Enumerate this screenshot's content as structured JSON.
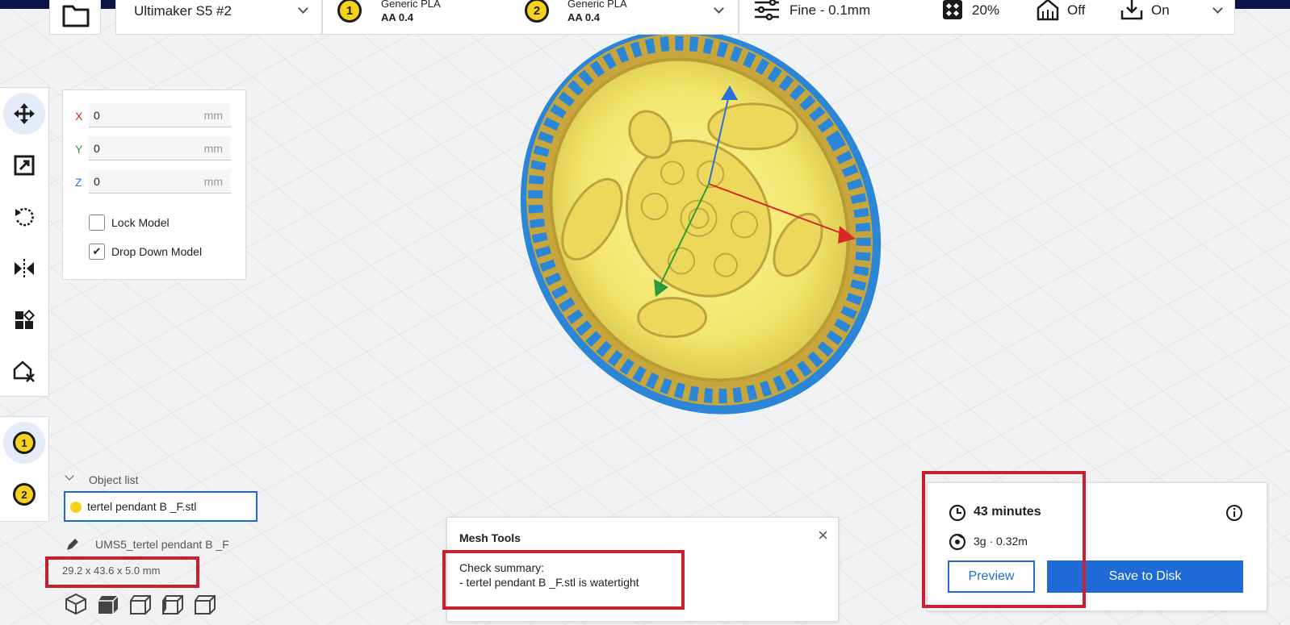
{
  "header": {
    "printer_name": "Ultimaker S5 #2",
    "extruder1": {
      "number": "1",
      "material": "Generic PLA",
      "nozzle": "AA 0.4"
    },
    "extruder2": {
      "number": "2",
      "material": "Generic PLA",
      "nozzle": "AA 0.4"
    },
    "profile": "Fine - 0.1mm",
    "infill": "20%",
    "support": "Off",
    "adhesion": "On"
  },
  "move_panel": {
    "x_label": "X",
    "x_value": "0",
    "y_label": "Y",
    "y_value": "0",
    "z_label": "Z",
    "z_value": "0",
    "unit": "mm",
    "lock_model": "Lock Model",
    "drop_down_model": "Drop Down Model",
    "drop_down_checkmark": "✔"
  },
  "extruder_select": {
    "e1": "1",
    "e2": "2"
  },
  "object_list": {
    "title": "Object list",
    "selected_item": "tertel pendant B _F.stl",
    "job_name": "UMS5_tertel pendant B _F",
    "dimensions": "29.2 x 43.6 x 5.0 mm"
  },
  "mesh_tools": {
    "title": "Mesh Tools",
    "summary_heading": "Check summary:",
    "summary_line": "- tertel pendant B _F.stl is watertight",
    "close": "×"
  },
  "print_info": {
    "time": "43 minutes",
    "material_usage": "3g · 0.32m",
    "preview_label": "Preview",
    "save_label": "Save to Disk"
  },
  "colors": {
    "accent": "#1e6ad6",
    "highlight_red": "#c8202f",
    "model_yellow": "#f5ea6a",
    "extruder_yellow": "#f5d31d"
  }
}
